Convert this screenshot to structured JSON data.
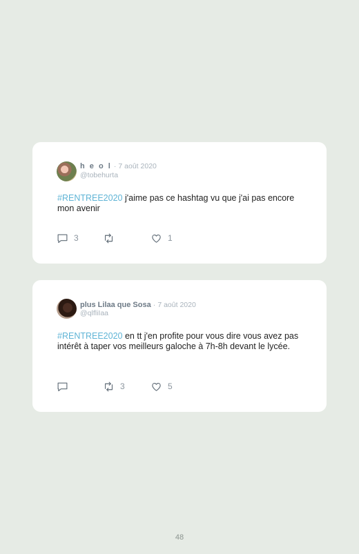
{
  "tweets": [
    {
      "display_name": "h e o l",
      "separator": "·",
      "date": "7 août 2020",
      "handle": "@tobehurta",
      "hashtag": "#RENTREE2020",
      "body": " j'aime pas ce hashtag vu que j'ai pas encore mon avenir",
      "replies": "3",
      "retweets": "",
      "likes": "1"
    },
    {
      "display_name": "plus Lilaa que Sosa",
      "separator": "·",
      "date": "7 août 2020",
      "handle": "@qlfliIaa",
      "hashtag": "#RENTREE2020",
      "body": " en tt j'en profite pour vous dire vous avez pas intérêt à taper vos meilleurs galoche à 7h-8h devant le lycée.",
      "replies": "",
      "retweets": "3",
      "likes": "5"
    }
  ],
  "icons": {
    "reply": "reply-icon",
    "retweet": "retweet-icon",
    "like": "heart-icon"
  },
  "page_number": "48"
}
